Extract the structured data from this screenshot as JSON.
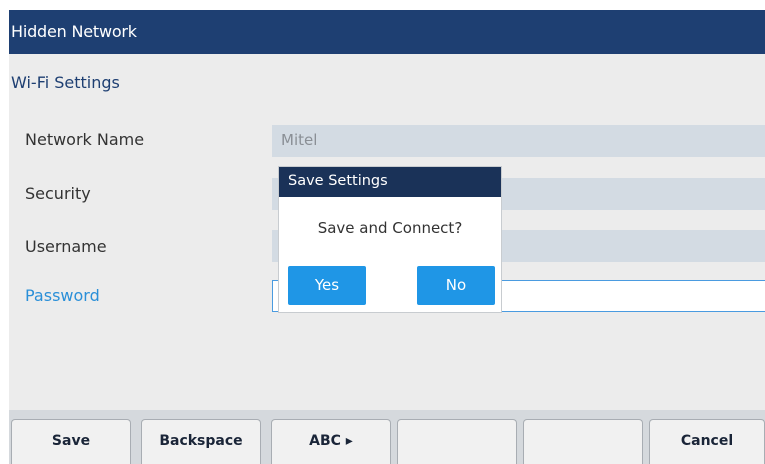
{
  "window": {
    "title": "Hidden Network"
  },
  "section": {
    "title": "Wi-Fi Settings"
  },
  "form": {
    "network_name": {
      "label": "Network Name",
      "value": "Mitel"
    },
    "security": {
      "label": "Security",
      "value": ""
    },
    "username": {
      "label": "Username",
      "value": ""
    },
    "password": {
      "label": "Password",
      "value": ""
    }
  },
  "dialog": {
    "title": "Save Settings",
    "message": "Save and Connect?",
    "yes_label": "Yes",
    "no_label": "No"
  },
  "softkeys": {
    "save": "Save",
    "backspace": "Backspace",
    "abc": "ABC ▸",
    "empty_1": "",
    "empty_2": "",
    "cancel": "Cancel"
  },
  "colors": {
    "title_bar": "#1e3f72",
    "dialog_title": "#1a3258",
    "accent": "#1f96e6",
    "active_label": "#2a8fd8",
    "field_bg": "#d3dbe3",
    "content_bg": "#ececec"
  }
}
